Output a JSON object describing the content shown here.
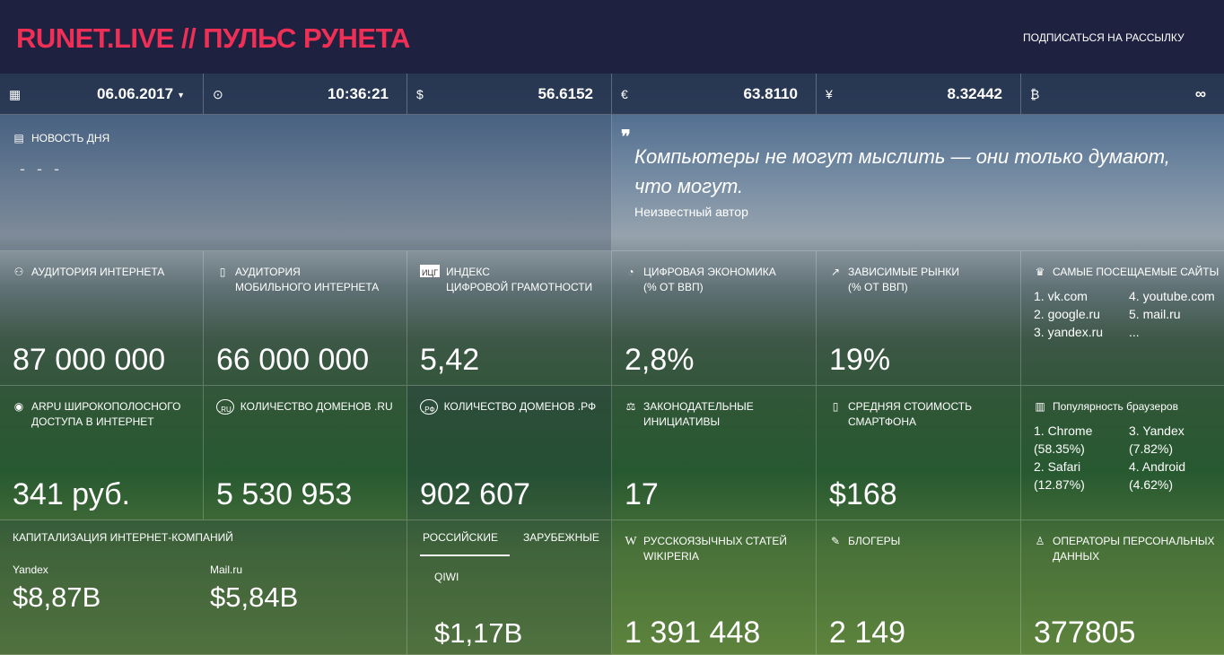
{
  "header": {
    "logo": "RUNET.LIVE // ПУЛЬС РУНЕТА",
    "subscribe": "ПОДПИСАТЬСЯ НА РАССЫЛКУ"
  },
  "ticker": [
    {
      "icon": "calendar-icon",
      "glyph": "▦",
      "value": "06.06.2017",
      "dropdown": true
    },
    {
      "icon": "clock-icon",
      "glyph": "⊙",
      "value": "10:36:21"
    },
    {
      "icon": "dollar-icon",
      "glyph": "$",
      "value": "56.6152"
    },
    {
      "icon": "euro-icon",
      "glyph": "€",
      "value": "63.8110"
    },
    {
      "icon": "yen-icon",
      "glyph": "¥",
      "value": "8.32442"
    },
    {
      "icon": "bitcoin-icon",
      "glyph": "₿",
      "value": "∞"
    }
  ],
  "news": {
    "title": "НОВОСТЬ ДНЯ",
    "content": "- - -"
  },
  "quote": {
    "text": "Компьютеры не могут мыслить — они только думают, что могут.",
    "author": "Неизвестный автор"
  },
  "stats_row1": [
    {
      "icon": "users-icon",
      "glyph": "👥",
      "title_1": "АУДИТОРИЯ ИНТЕРНЕТА",
      "title_2": "",
      "value": "87 000 000"
    },
    {
      "icon": "mobile-icon",
      "glyph": "▯",
      "title_1": "АУДИТОРИЯ",
      "title_2": "МОБИЛЬНОГО ИНТЕРНЕТА",
      "value": "66 000 000"
    },
    {
      "icon": "index-icon",
      "glyph": "ИЦГ",
      "title_1": "ИНДЕКС",
      "title_2": "ЦИФРОВОЙ ГРАМОТНОСТИ",
      "value": "5,42"
    },
    {
      "icon": "pie-chart-icon",
      "glyph": "◔",
      "title_1": "ЦИФРОВАЯ ЭКОНОМИКА",
      "title_2": "(% ОТ ВВП)",
      "value": "2,8%"
    },
    {
      "icon": "trend-icon",
      "glyph": "↗",
      "title_1": "ЗАВИСИМЫЕ РЫНКИ",
      "title_2": "(% ОТ ВВП)",
      "value": "19%"
    }
  ],
  "sites": {
    "icon": "trophy-icon",
    "glyph": "🏆",
    "title": "САМЫЕ ПОСЕЩАЕМЫЕ САЙТЫ",
    "items": [
      "1. vk.com",
      "4. youtube.com",
      "2. google.ru",
      "5. mail.ru",
      "3. yandex.ru",
      "..."
    ]
  },
  "stats_row2": [
    {
      "icon": "globe-icon",
      "glyph": "◉",
      "title_1": "ARPU ШИРОКОПОЛОСНОГО",
      "title_2": "ДОСТУПА В ИНТЕРНЕТ",
      "value": "341 руб."
    },
    {
      "icon": "ru-domain-icon",
      "glyph": ".RU",
      "title_1": "КОЛИЧЕСТВО ДОМЕНОВ .RU",
      "title_2": "",
      "value": "5 530 953"
    },
    {
      "icon": "rf-domain-icon",
      "glyph": ".РФ",
      "title_1": "КОЛИЧЕСТВО ДОМЕНОВ .РФ",
      "title_2": "",
      "value": "902 607"
    },
    {
      "icon": "gavel-icon",
      "glyph": "⚖",
      "title_1": "ЗАКОНОДАТЕЛЬНЫЕ",
      "title_2": "ИНИЦИАТИВЫ",
      "value": "17"
    },
    {
      "icon": "smartphone-icon",
      "glyph": "▯",
      "title_1": "СРЕДНЯЯ СТОИМОСТЬ",
      "title_2": "СМАРТФОНА",
      "value": "$168"
    }
  ],
  "browsers": {
    "icon": "bar-chart-icon",
    "glyph": "▥",
    "title": "Популярность браузеров",
    "items": [
      "1. Chrome",
      "3. Yandex",
      "(58.35%)",
      "(7.82%)",
      "2. Safari",
      "4. Android",
      "(12.87%)",
      "(4.62%)"
    ]
  },
  "capitalization": {
    "title": "КАПИТАЛИЗАЦИЯ ИНТЕРНЕТ-КОМПАНИЙ",
    "companies": [
      {
        "name": "Yandex",
        "value": "$8,87B"
      },
      {
        "name": "Mail.ru",
        "value": "$5,84B"
      }
    ]
  },
  "tabs": {
    "russian": "РОССИЙСКИЕ",
    "foreign": "ЗАРУБЕЖНЫЕ",
    "company": {
      "name": "QIWI",
      "value": "$1,17B"
    }
  },
  "stats_row3": [
    {
      "icon": "wikipedia-icon",
      "glyph": "W",
      "title_1": "РУССКОЯЗЫЧНЫХ СТАТЕЙ",
      "title_2": "WIKIPERIA",
      "value": "1 391 448"
    },
    {
      "icon": "pencil-icon",
      "glyph": "✎",
      "title_1": "БЛОГЕРЫ",
      "title_2": "",
      "value": "2 149"
    },
    {
      "icon": "user-icon",
      "glyph": "♙",
      "title_1": "ОПЕРАТОРЫ ПЕРСОНАЛЬНЫХ",
      "title_2": "ДАННЫХ",
      "value": "377805"
    }
  ]
}
